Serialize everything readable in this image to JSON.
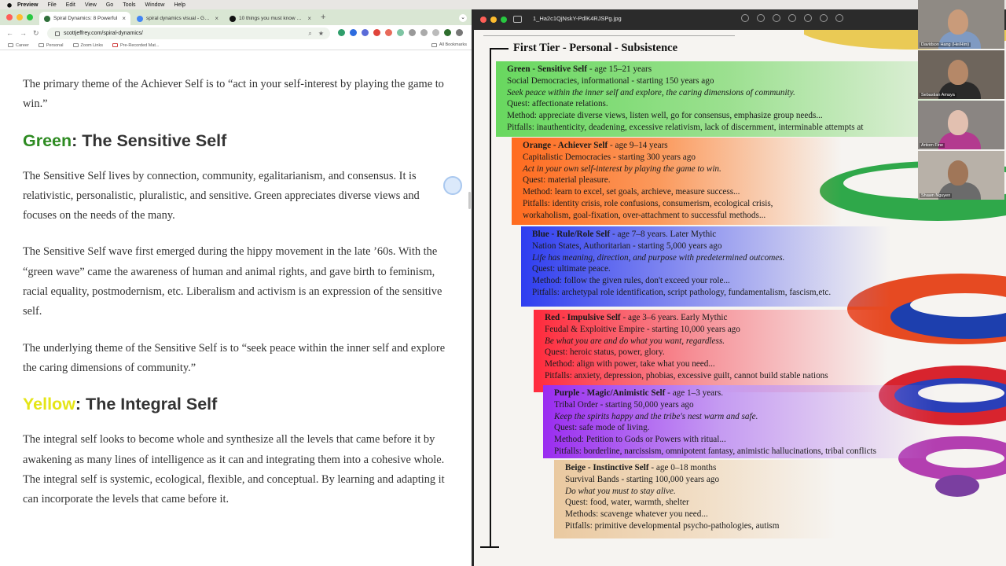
{
  "menubar": {
    "app": "Preview",
    "items": [
      "File",
      "Edit",
      "View",
      "Go",
      "Tools",
      "Window",
      "Help"
    ]
  },
  "chrome": {
    "tabs": [
      {
        "title": "Spiral Dynamics: 8 Powerful",
        "active": true
      },
      {
        "title": "spiral dynamics visual - Goog",
        "active": false
      },
      {
        "title": "10 things you must know abo",
        "active": false
      }
    ],
    "url": "scottjeffrey.com/spiral-dynamics/",
    "bookmarks": [
      "Career",
      "Personal",
      "Zoom Links",
      "Pre-Recorded Mat..."
    ],
    "all_bookmarks": "All Bookmarks"
  },
  "article": {
    "p_achiever": "The primary theme of the Achiever Self is to “act in your self-interest by playing the game to win.”",
    "h_green_color": "Green",
    "h_green_rest": ": The Sensitive Self",
    "p_sensitive_1": "The Sensitive Self lives by connection, community, egalitarianism, and consensus. It is relativistic, personalistic, pluralistic, and sensitive. Green appreciates diverse views and focuses on the needs of the many.",
    "p_sensitive_2": "The Sensitive Self wave first emerged during the hippy movement in the late ’60s. With the “green wave” came the awareness of human and animal rights, and gave birth to feminism, racial equality, postmodernism, etc. Liberalism and activism is an expression of the sensitive self.",
    "p_sensitive_3": "The underlying theme of the Sensitive Self is to “seek peace within the inner self and explore the caring dimensions of community.”",
    "h_yellow_color": "Yellow",
    "h_yellow_rest": ": The Integral Self",
    "p_integral": "The integral self looks to become whole and synthesize all the levels that came before it by awakening as many lines of intelligence as it can and integrating them into a cohesive whole. The integral self is systemic, ecological, flexible, and conceptual. By learning and adapting it can incorporate the levels that came before it."
  },
  "preview": {
    "filename": "1_Ha2c1QjNskY-PdlK4RJSPg.jpg",
    "tier_heading": "First Tier - Personal - Subsistence",
    "levels": {
      "green": {
        "name": "Green - Sensitive Self",
        "age": " - age 15–21 years",
        "l1": "Social Democracies, informational - starting 150 years ago",
        "motto": "Seek peace within the inner self and explore, the caring dimensions of community.",
        "l3": "Quest: affectionate relations.",
        "l4": "Method: appreciate diverse views, listen well, go for consensus, emphasize group needs...",
        "l5": "Pitfalls: inauthenticity, deadening, excessive relativism, lack of discernment, interminable attempts at"
      },
      "orange": {
        "name": "Orange - Achiever Self",
        "age": " - age 9–14 years",
        "l1": "Capitalistic Democracies - starting 300 years ago",
        "motto": "Act in your own self-interest by playing the game to win.",
        "l3": "Quest: material pleasure.",
        "l4": "Method: learn to excel, set goals, archieve, measure success...",
        "l5": "Pitfalls: identity crisis, role confusions, consumerism, ecological crisis,",
        "l6": "workaholism, goal-fixation, over-attachment to successful methods..."
      },
      "blue": {
        "name": "Blue - Rule/Role Self",
        "age": " - age 7–8 years. Later Mythic",
        "l1": "Nation States, Authoritarian - starting 5,000 years ago",
        "motto": "Life has meaning, direction, and purpose with predetermined outcomes.",
        "l3": "Quest: ultimate peace.",
        "l4": "Method: follow the given rules, don't exceed your role...",
        "l5": "Pitfalls: archetypal role identification, script pathology, fundamentalism, fascism,etc."
      },
      "red": {
        "name": "Red - Impulsive Self",
        "age": " - age 3–6 years. Early Mythic",
        "l1": "Feudal & Exploitive Empire - starting 10,000 years ago",
        "motto": "Be what you are and do what you want, regardless.",
        "l3": "Quest: heroic status, power, glory.",
        "l4": "Method: align with power, take what you need...",
        "l5": "Pitfalls: anxiety, depression, phobias, excessive guilt, cannot build stable nations"
      },
      "purple": {
        "name": "Purple - Magic/Animistic Self",
        "age": " - age 1–3 years.",
        "l1": "Tribal Order - starting 50,000 years ago",
        "motto": "Keep the spirits happy and the tribe's nest warm and safe.",
        "l3": "Quest: safe mode of living.",
        "l4": "Method: Petition to Gods or Powers with ritual...",
        "l5": "Pitfalls: borderline, narcissism, omnipotent fantasy, animistic hallucinations, tribal conflicts"
      },
      "beige": {
        "name": "Beige - Instinctive Self",
        "age": " - age 0–18 months",
        "l1": "Survival Bands - starting 100,000 years ago",
        "motto": "Do what you must to stay alive.",
        "l3": "Quest: food, water, warmth, shelter",
        "l4": "Methods: scavenge whatever you need...",
        "l5": "Pitfalls: primitive developmental psycho-pathologies, autism"
      }
    }
  },
  "participants": [
    {
      "name": "Davidson Hang (He/Him)"
    },
    {
      "name": "Sebastian Amaya"
    },
    {
      "name": "Artiom Fine"
    },
    {
      "name": "Shawn Nguyen"
    }
  ],
  "colors": {
    "green_heading": "#2e8b22",
    "yellow_heading": "#e5e517"
  }
}
